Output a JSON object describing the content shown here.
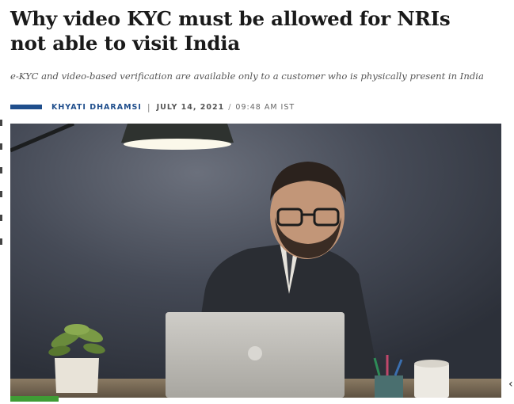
{
  "article": {
    "headline": "Why video KYC must be allowed for NRIs not able to visit India",
    "subheadline": "e-KYC and video-based verification are available only to a customer who is physically present in India",
    "author": "KHYATI DHARAMSI",
    "date": "JULY 14, 2021",
    "time": "09:48 AM IST"
  },
  "image": {
    "subject": "man-with-laptop-under-lamp",
    "colors": {
      "background": "#3a3f4b",
      "lamp": "#2e322f",
      "suit": "#2a2d33",
      "laptop": "#b9b7b2"
    }
  },
  "icons": {
    "carousel_prev": "‹"
  },
  "colors": {
    "accent": "#1f4e8c",
    "indicator": "#3f9c35"
  }
}
